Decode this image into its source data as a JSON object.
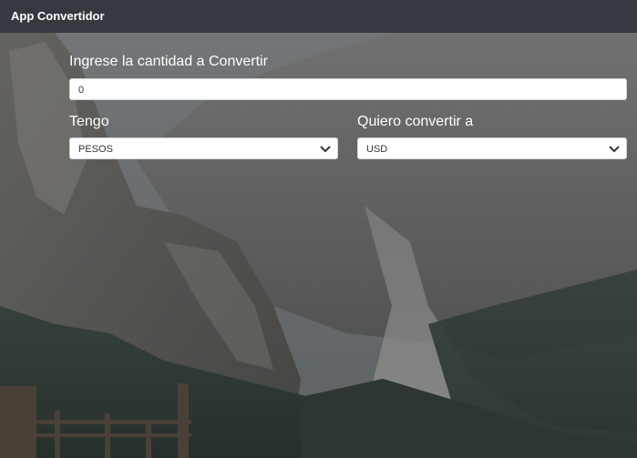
{
  "app": {
    "title": "App Convertidor"
  },
  "form": {
    "amount_label": "Ingrese la cantidad a Convertir",
    "amount_value": "0",
    "from_label": "Tengo",
    "from_selected": "PESOS",
    "to_label": "Quiero convertir a",
    "to_selected": "USD"
  },
  "theme": {
    "topbar_color": "#343a40",
    "label_color": "#ffffff"
  }
}
